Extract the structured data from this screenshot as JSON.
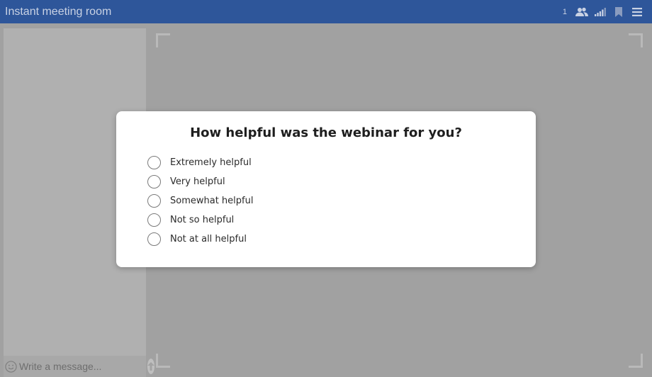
{
  "header": {
    "title": "Instant meeting room",
    "participant_count": "1",
    "icons": [
      "participants-icon",
      "signal-icon",
      "bookmark-icon",
      "menu-icon"
    ]
  },
  "chat": {
    "placeholder": "Write a message...",
    "icons": [
      "emoji-icon",
      "send-icon"
    ]
  },
  "poll": {
    "question": "How helpful was the webinar for you?",
    "options": [
      {
        "label": "Extremely helpful"
      },
      {
        "label": "Very helpful"
      },
      {
        "label": "Somewhat helpful"
      },
      {
        "label": "Not so helpful"
      },
      {
        "label": "Not at all helpful"
      }
    ]
  },
  "colors": {
    "topbar": "#2e569a",
    "overlay": "#a1a1a1",
    "modal": "#ffffff"
  }
}
